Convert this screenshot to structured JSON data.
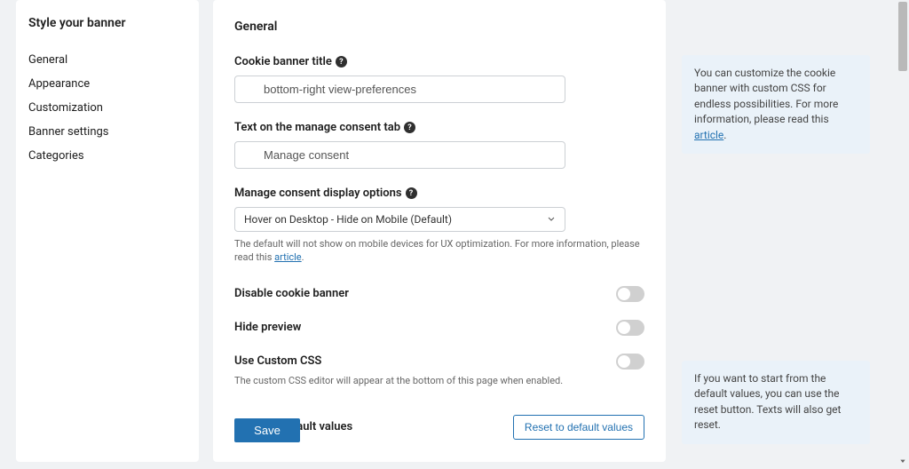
{
  "sidebar": {
    "title": "Style your banner",
    "items": [
      {
        "label": "General"
      },
      {
        "label": "Appearance"
      },
      {
        "label": "Customization"
      },
      {
        "label": "Banner settings"
      },
      {
        "label": "Categories"
      }
    ]
  },
  "main": {
    "heading": "General",
    "fields": {
      "cookie_title": {
        "label": "Cookie banner title",
        "value": "bottom-right view-preferences"
      },
      "manage_tab": {
        "label": "Text on the manage consent tab",
        "value": "Manage consent"
      },
      "display_options": {
        "label": "Manage consent display options",
        "selected": "Hover on Desktop - Hide on Mobile (Default)",
        "help_prefix": "The default will not show on mobile devices for UX optimization. For more information, please read this ",
        "help_link": "article",
        "help_suffix": "."
      },
      "disable_banner": {
        "label": "Disable cookie banner"
      },
      "hide_preview": {
        "label": "Hide preview"
      },
      "custom_css": {
        "label": "Use Custom CSS",
        "sub": "The custom CSS editor will appear at the bottom of this page when enabled."
      },
      "reset": {
        "label": "Reset to default values",
        "button": "Reset to default values"
      }
    },
    "save_label": "Save"
  },
  "info": {
    "top_prefix": "You can customize the cookie banner with custom CSS for endless possibilities. For more information, please read this ",
    "top_link": "article",
    "top_suffix": ".",
    "bottom": "If you want to start from the default values, you can use the reset button. Texts will also get reset."
  }
}
